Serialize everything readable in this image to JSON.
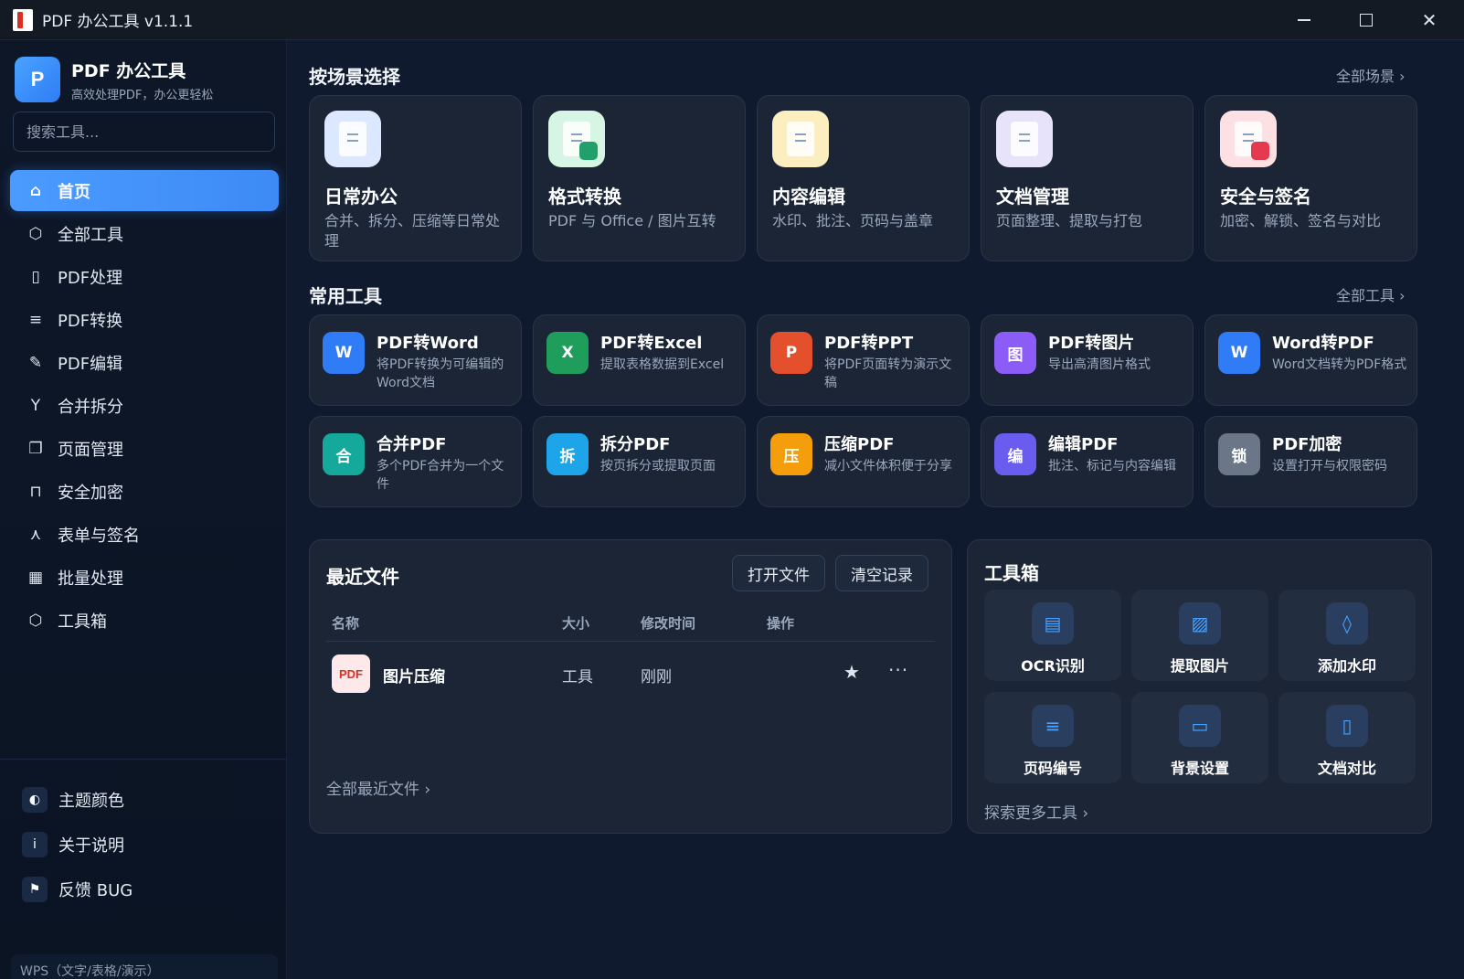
{
  "window": {
    "title": "PDF 办公工具 v1.1.1"
  },
  "sidebar": {
    "brand_name": "PDF 办公工具",
    "brand_logo": "P",
    "brand_sub": "高效处理PDF，办公更轻松",
    "search_placeholder": "搜索工具...",
    "items": [
      {
        "label": "首页",
        "icon": "home-icon"
      },
      {
        "label": "全部工具",
        "icon": "cube-icon"
      },
      {
        "label": "PDF处理",
        "icon": "file-icon"
      },
      {
        "label": "PDF转换",
        "icon": "convert-icon"
      },
      {
        "label": "PDF编辑",
        "icon": "pencil-icon"
      },
      {
        "label": "合并拆分",
        "icon": "merge-icon"
      },
      {
        "label": "页面管理",
        "icon": "pages-icon"
      },
      {
        "label": "安全加密",
        "icon": "lock-icon"
      },
      {
        "label": "表单与签名",
        "icon": "signature-icon"
      },
      {
        "label": "批量处理",
        "icon": "grid-icon"
      },
      {
        "label": "工具箱",
        "icon": "toolbox-icon"
      }
    ],
    "bottom": [
      {
        "label": "主题颜色",
        "icon": "theme-icon"
      },
      {
        "label": "关于说明",
        "icon": "info-icon"
      },
      {
        "label": "反馈 BUG",
        "icon": "flag-icon"
      }
    ],
    "wps": "WPS（文字/表格/演示）"
  },
  "scenes": {
    "title": "按场景选择",
    "link": "全部场景 ›",
    "items": [
      {
        "name": "日常办公",
        "desc": "合并、拆分、压缩等日常处理",
        "color": "#dce8ff",
        "badge": ""
      },
      {
        "name": "格式转换",
        "desc": "PDF 与 Office / 图片互转",
        "color": "#d7f5e4",
        "badge": "#22a06b"
      },
      {
        "name": "内容编辑",
        "desc": "水印、批注、页码与盖章",
        "color": "#fdeec0",
        "badge": ""
      },
      {
        "name": "文档管理",
        "desc": "页面整理、提取与打包",
        "color": "#e6e3fb",
        "badge": ""
      },
      {
        "name": "安全与签名",
        "desc": "加密、解锁、签名与对比",
        "color": "#fde0e3",
        "badge": "#e5394f"
      }
    ]
  },
  "tools": {
    "title": "常用工具",
    "link": "全部工具 ›",
    "items": [
      {
        "name": "PDF转Word",
        "desc": "将PDF转换为可编辑的Word文档",
        "badge": "W",
        "color": "#2f7cf6"
      },
      {
        "name": "PDF转Excel",
        "desc": "提取表格数据到Excel",
        "badge": "X",
        "color": "#1f9d5a"
      },
      {
        "name": "PDF转PPT",
        "desc": "将PDF页面转为演示文稿",
        "badge": "P",
        "color": "#e4502b"
      },
      {
        "name": "PDF转图片",
        "desc": "导出高清图片格式",
        "badge": "图",
        "color": "#8b5cf6"
      },
      {
        "name": "Word转PDF",
        "desc": "Word文档转为PDF格式",
        "badge": "W",
        "color": "#2f7cf6"
      },
      {
        "name": "合并PDF",
        "desc": "多个PDF合并为一个文件",
        "badge": "合",
        "color": "#14a99a"
      },
      {
        "name": "拆分PDF",
        "desc": "按页拆分或提取页面",
        "badge": "拆",
        "color": "#1ea5e9"
      },
      {
        "name": "压缩PDF",
        "desc": "减小文件体积便于分享",
        "badge": "压",
        "color": "#f59e0b"
      },
      {
        "name": "编辑PDF",
        "desc": "批注、标记与内容编辑",
        "badge": "编",
        "color": "#6b5cf0"
      },
      {
        "name": "PDF加密",
        "desc": "设置打开与权限密码",
        "badge": "锁",
        "color": "#6b7789"
      }
    ]
  },
  "recent": {
    "title": "最近文件",
    "open_btn": "打开文件",
    "clear_btn": "清空记录",
    "headers": {
      "name": "名称",
      "size": "大小",
      "time": "修改时间",
      "ops": "操作"
    },
    "rows": [
      {
        "thumb": "PDF",
        "name": "图片压缩",
        "size": "工具",
        "time": "刚刚"
      }
    ],
    "star": "★",
    "more": "···",
    "link": "全部最近文件 ›"
  },
  "toolbox": {
    "title": "工具箱",
    "items": [
      {
        "label": "OCR识别",
        "icon": "ocr-icon",
        "glyph": "▤"
      },
      {
        "label": "提取图片",
        "icon": "image-icon",
        "glyph": "▨"
      },
      {
        "label": "添加水印",
        "icon": "droplet-icon",
        "glyph": "◊"
      },
      {
        "label": "页码编号",
        "icon": "page-number-icon",
        "glyph": "≡"
      },
      {
        "label": "背景设置",
        "icon": "background-icon",
        "glyph": "▭"
      },
      {
        "label": "文档对比",
        "icon": "document-compare-icon",
        "glyph": "▯"
      }
    ],
    "link": "探索更多工具 ›"
  }
}
